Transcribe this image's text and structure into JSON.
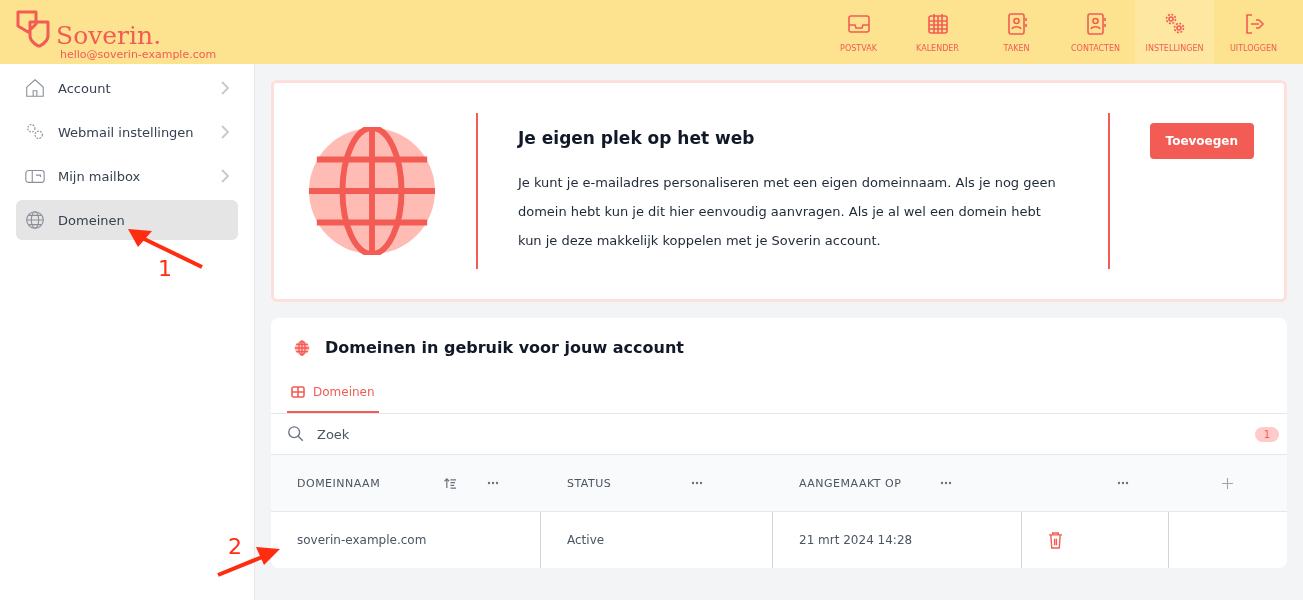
{
  "header": {
    "brand": "Soverin.",
    "email": "hello@soverin-example.com",
    "nav": [
      {
        "label": "POSTVAK",
        "selected": false
      },
      {
        "label": "KALENDER",
        "selected": false
      },
      {
        "label": "TAKEN",
        "selected": false
      },
      {
        "label": "CONTACTEN",
        "selected": false
      },
      {
        "label": "INSTELLINGEN",
        "selected": true
      },
      {
        "label": "UITLOGGEN",
        "selected": false
      }
    ]
  },
  "sidebar": {
    "items": [
      {
        "label": "Account",
        "selected": false
      },
      {
        "label": "Webmail instellingen",
        "selected": false
      },
      {
        "label": "Mijn mailbox",
        "selected": false
      },
      {
        "label": "Domeinen",
        "selected": true
      }
    ]
  },
  "promo": {
    "title": "Je eigen plek op het web",
    "text": "Je kunt je e-mailadres personaliseren met een eigen domeinnaam. Als je nog geen domein hebt kun je dit hier eenvoudig aanvragen. Als je al wel een domein hebt kun je deze makkelijk koppelen met je Soverin account.",
    "button": "Toevoegen"
  },
  "domains": {
    "title": "Domeinen in gebruik voor jouw account",
    "tabs": [
      {
        "label": "Domeinen",
        "selected": true
      }
    ],
    "search": {
      "placeholder": "Zoek"
    },
    "count": "1",
    "columns": [
      "DOMEINNAAM",
      "STATUS",
      "AANGEMAAKT OP"
    ],
    "rows": [
      {
        "domain": "soverin-example.com",
        "status": "Active",
        "created": "21 mrt 2024 14:28"
      }
    ]
  },
  "annotations": [
    {
      "label": "1",
      "kind": "sidebar"
    },
    {
      "label": "2",
      "kind": "row"
    }
  ]
}
